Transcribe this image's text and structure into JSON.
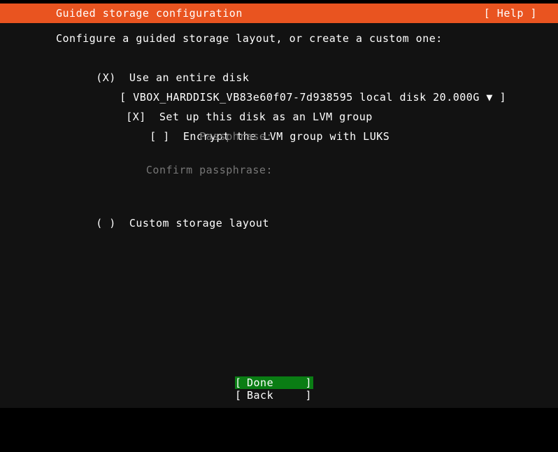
{
  "header": {
    "title": "Guided storage configuration",
    "help_label": "[ Help ]",
    "accent_color": "#e95420"
  },
  "main": {
    "intro": "Configure a guided storage layout, or create a custom one:",
    "options": {
      "entire_disk": {
        "marker": "(X)",
        "label": "Use an entire disk",
        "selected": true
      },
      "custom_layout": {
        "marker": "( )",
        "label": "Custom storage layout",
        "selected": false
      }
    },
    "disk_select": {
      "bracket_open": "[",
      "value": "VBOX_HARDDISK_VB83e60f07-7d938595 local disk 20.000G",
      "arrow": "▼",
      "bracket_close": "]"
    },
    "lvm_checkbox": {
      "marker": "[X]",
      "label": "Set up this disk as an LVM group",
      "checked": true
    },
    "luks_checkbox": {
      "marker": "[ ]",
      "label": "Encrypt the LVM group with LUKS",
      "checked": false
    },
    "passphrase_label": "Passphrase:",
    "confirm_passphrase_label": "Confirm passphrase:",
    "disabled_text_color": "#777777"
  },
  "footer": {
    "done": {
      "bracket_open": "[",
      "label": "Done",
      "bracket_close": "]",
      "selected": true,
      "highlight_color": "#0a7d14"
    },
    "back": {
      "bracket_open": "[",
      "label": "Back",
      "bracket_close": "]",
      "selected": false
    }
  }
}
